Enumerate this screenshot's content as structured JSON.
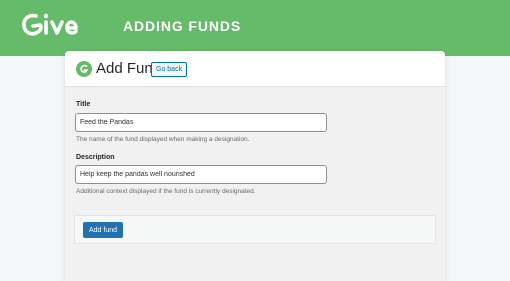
{
  "banner": {
    "title": "ADDING FUNDS",
    "logo_icon": "give-logo"
  },
  "header": {
    "icon": "give-mark-icon",
    "title": "Add Fund",
    "go_back_label": "Go back"
  },
  "form": {
    "title_field": {
      "label": "Title",
      "value": "Feed the Pandas",
      "description": "The name of the fund displayed when making a designation."
    },
    "description_field": {
      "label": "Description",
      "value": "Help keep the pandas well nourished",
      "description": "Additional context displayed if the fund is currently designated."
    },
    "submit_label": "Add fund"
  },
  "colors": {
    "banner": "#66bb6a",
    "accent": "#2271b1",
    "background": "#f3f7f8"
  }
}
